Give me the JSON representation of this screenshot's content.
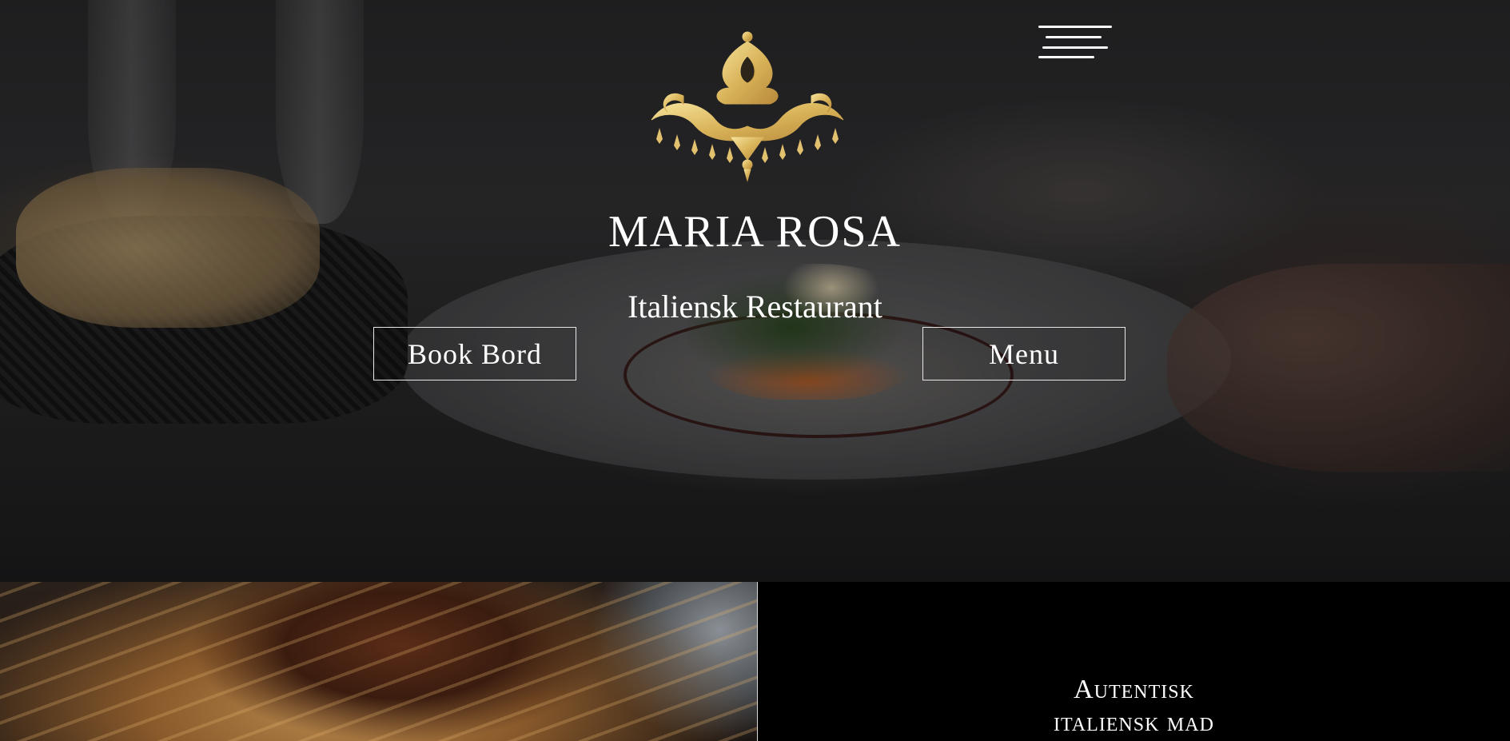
{
  "restaurant": {
    "name": "MARIA ROSA",
    "tagline": "Italiensk Restaurant"
  },
  "buttons": {
    "book": "Book Bord",
    "menu": "Menu"
  },
  "section": {
    "heading_line1": "Autentisk",
    "heading_line2": "italiensk mad"
  },
  "colors": {
    "gold": "#d9b45a",
    "gold_light": "#f1d98a",
    "background": "#000000",
    "text": "#ffffff"
  },
  "icons": {
    "menu": "hamburger-menu-icon",
    "logo": "chandelier-logo-icon"
  }
}
